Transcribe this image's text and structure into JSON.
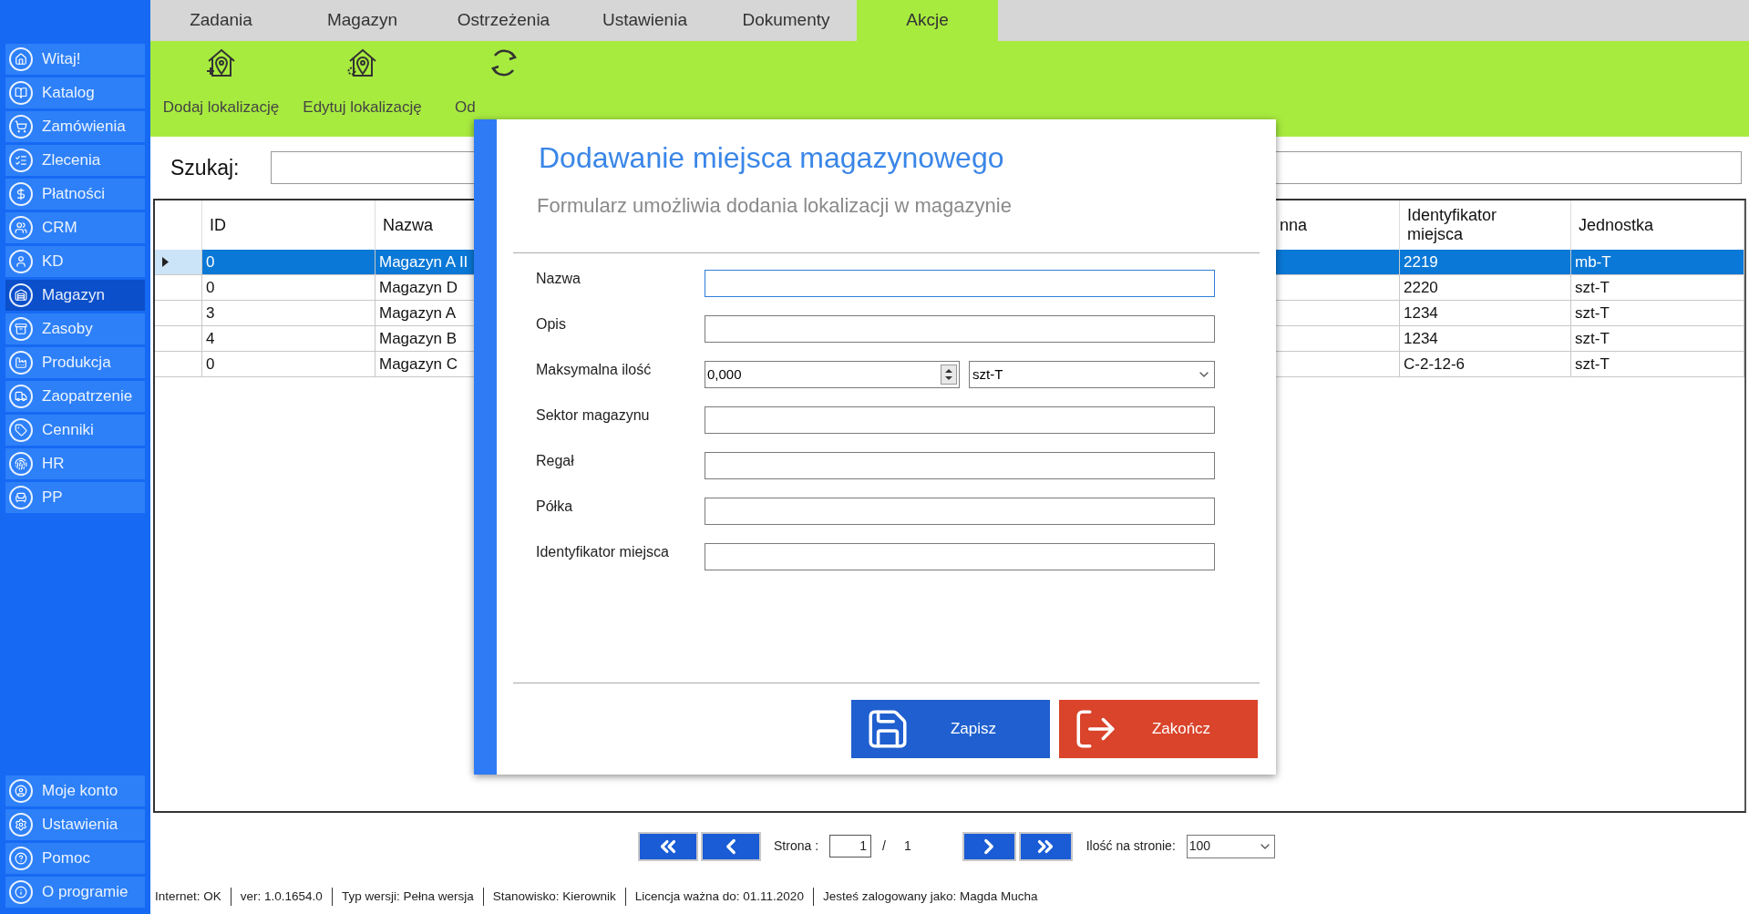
{
  "sidebar": {
    "items": [
      {
        "label": "Witaj!",
        "selected": false
      },
      {
        "label": "Katalog",
        "selected": false
      },
      {
        "label": "Zamówienia",
        "selected": false
      },
      {
        "label": "Zlecenia",
        "selected": false
      },
      {
        "label": "Płatności",
        "selected": false
      },
      {
        "label": "CRM",
        "selected": false
      },
      {
        "label": "KD",
        "selected": false
      },
      {
        "label": "Magazyn",
        "selected": true
      },
      {
        "label": "Zasoby",
        "selected": false
      },
      {
        "label": "Produkcja",
        "selected": false
      },
      {
        "label": "Zaopatrzenie",
        "selected": false
      },
      {
        "label": "Cenniki",
        "selected": false
      },
      {
        "label": "HR",
        "selected": false
      },
      {
        "label": "PP",
        "selected": false
      }
    ],
    "bottom_items": [
      {
        "label": "Moje konto"
      },
      {
        "label": "Ustawienia"
      },
      {
        "label": "Pomoc"
      },
      {
        "label": "O programie"
      }
    ]
  },
  "tabs": [
    {
      "label": "Zadania",
      "selected": false
    },
    {
      "label": "Magazyn",
      "selected": false
    },
    {
      "label": "Ostrzeżenia",
      "selected": false
    },
    {
      "label": "Ustawienia",
      "selected": false
    },
    {
      "label": "Dokumenty",
      "selected": false
    },
    {
      "label": "Akcje",
      "selected": true
    }
  ],
  "toolbar": [
    {
      "label": "Dodaj lokalizację",
      "kind": "add"
    },
    {
      "label": "Edytuj lokalizację",
      "kind": "edit"
    },
    {
      "label": "Od",
      "kind": "refresh"
    }
  ],
  "search": {
    "label": "Szukaj:"
  },
  "table": {
    "columns": [
      "ID",
      "Nazwa",
      "nna",
      "Identyfikator miejsca",
      "Jednostka"
    ],
    "rows": [
      {
        "id": "0",
        "name": "Magazyn A II",
        "place_id": "2219",
        "unit": "mb-T",
        "selected": true
      },
      {
        "id": "0",
        "name": "Magazyn D",
        "place_id": "2220",
        "unit": "szt-T",
        "selected": false
      },
      {
        "id": "3",
        "name": "Magazyn A",
        "place_id": "1234",
        "unit": "szt-T",
        "selected": false
      },
      {
        "id": "4",
        "name": "Magazyn B",
        "place_id": "1234",
        "unit": "szt-T",
        "selected": false
      },
      {
        "id": "0",
        "name": "Magazyn C",
        "place_id": "C-2-12-6",
        "unit": "szt-T",
        "selected": false
      }
    ]
  },
  "dialog": {
    "title": "Dodawanie miejsca magazynowego",
    "subtitle": "Formularz umożliwia dodania lokalizacji w magazynie",
    "fields": [
      {
        "label": "Nazwa",
        "kind": "text",
        "focused": true
      },
      {
        "label": "Opis",
        "kind": "text",
        "focused": false
      },
      {
        "label": "Maksymalna ilość",
        "kind": "quantity",
        "value": "0,000",
        "unit": "szt-T",
        "focused": false
      },
      {
        "label": "Sektor magazynu",
        "kind": "text",
        "focused": false
      },
      {
        "label": "Regał",
        "kind": "text",
        "focused": false
      },
      {
        "label": "Półka",
        "kind": "text",
        "focused": false
      },
      {
        "label": "Identyfikator miejsca",
        "kind": "text",
        "focused": false
      }
    ],
    "buttons": [
      {
        "label": "Zapisz",
        "kind": "save"
      },
      {
        "label": "Zakończ",
        "kind": "close"
      }
    ]
  },
  "pagination": {
    "page_label": "Strona :",
    "page": "1",
    "separator": "/",
    "total": "1",
    "per_page_label": "Ilość na stronie:",
    "per_page": "100"
  },
  "status_bar": [
    "Internet: OK",
    "ver: 1.0.1654.0",
    "Typ wersji: Pełna wersja",
    "Stanowisko: Kierownik",
    "Licencja ważna do: 01.11.2020",
    "Jesteś zalogowany jako: Magda Mucha"
  ]
}
